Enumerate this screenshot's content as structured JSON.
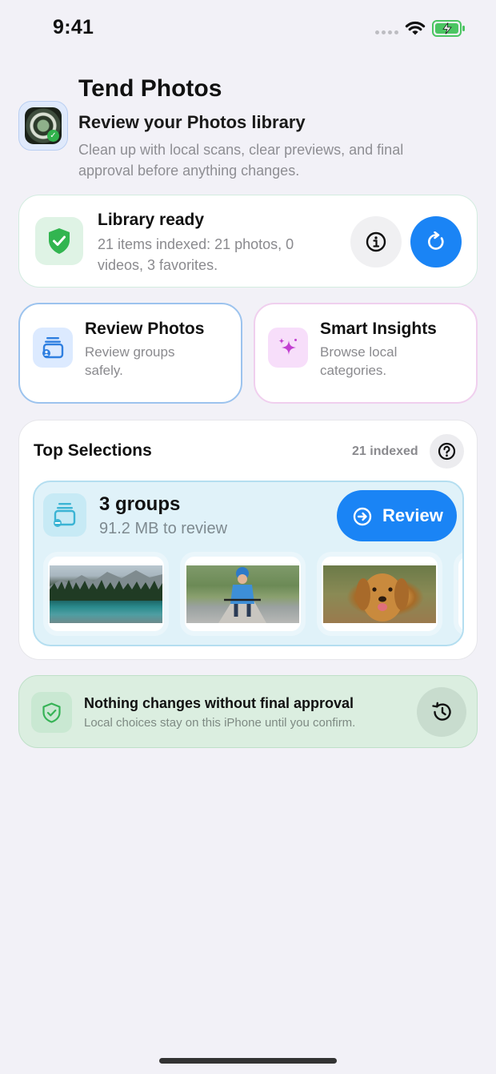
{
  "status_bar": {
    "time": "9:41"
  },
  "header": {
    "app_name": "Tend Photos",
    "subtitle": "Review your Photos library",
    "description": "Clean up with local scans, clear previews, and final approval before anything changes."
  },
  "library_status": {
    "title": "Library ready",
    "description": "21 items indexed: 21 photos, 0 videos, 3 favorites."
  },
  "tiles": [
    {
      "title": "Review Photos",
      "description": "Review groups safely.",
      "icon": "photo-stack-icon"
    },
    {
      "title": "Smart Insights",
      "description": "Browse local categories.",
      "icon": "sparkles-icon"
    }
  ],
  "top_selections": {
    "title": "Top Selections",
    "count_label": "21 indexed",
    "groups": {
      "title": "3 groups",
      "size_label": "91.2 MB to review",
      "review_label": "Review"
    },
    "thumbnails": [
      "mountain lake",
      "child on bike",
      "golden retriever"
    ]
  },
  "approval": {
    "title": "Nothing changes without final approval",
    "description": "Local choices stay on this iPhone until you confirm."
  },
  "colors": {
    "accent": "#1a84f5",
    "success": "#31b24c",
    "insights": "#c23fd1",
    "background": "#f2f1f7"
  }
}
